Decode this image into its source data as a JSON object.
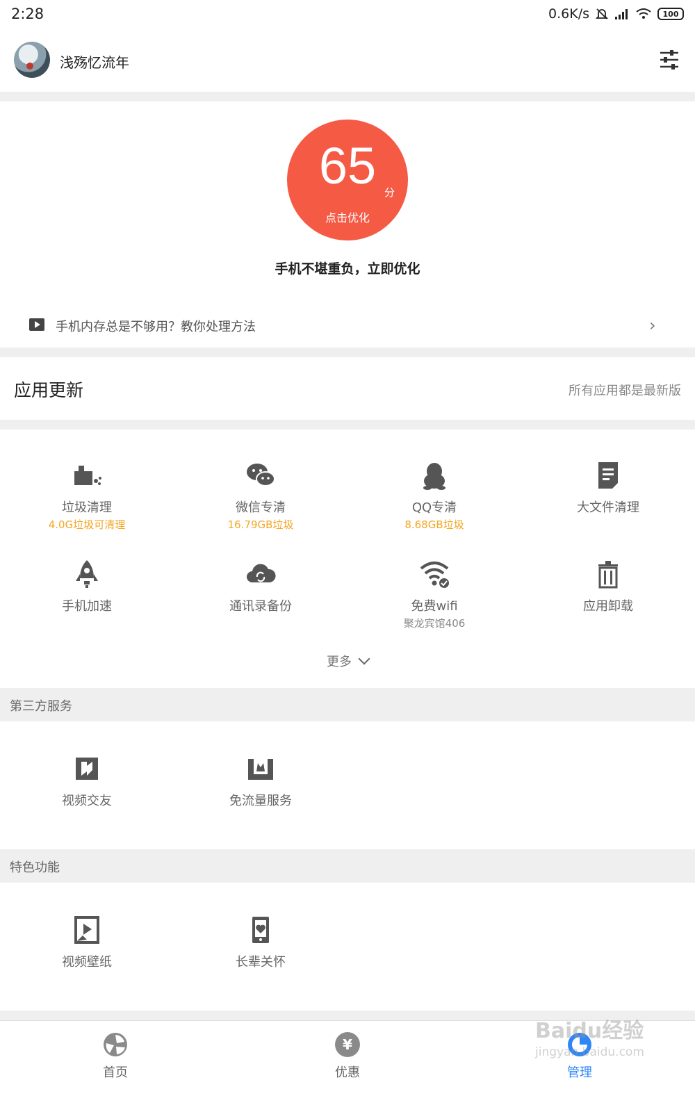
{
  "status_bar": {
    "time": "2:28",
    "speed": "0.6K/s",
    "battery": "100"
  },
  "header": {
    "username": "浅殇忆流年"
  },
  "score": {
    "value": "65",
    "unit": "分",
    "action": "点击优化",
    "message": "手机不堪重负，立即优化"
  },
  "tip": {
    "text": "手机内存总是不够用？教你处理方法"
  },
  "app_update": {
    "title": "应用更新",
    "status": "所有应用都是最新版"
  },
  "tools": [
    {
      "label": "垃圾清理",
      "sub": "4.0G垃圾可清理",
      "icon": "broom-icon"
    },
    {
      "label": "微信专清",
      "sub": "16.79GB垃圾",
      "icon": "wechat-icon"
    },
    {
      "label": "QQ专清",
      "sub": "8.68GB垃圾",
      "icon": "qq-penguin-icon"
    },
    {
      "label": "大文件清理",
      "sub": "",
      "icon": "document-icon"
    },
    {
      "label": "手机加速",
      "sub": "",
      "icon": "rocket-icon"
    },
    {
      "label": "通讯录备份",
      "sub": "",
      "icon": "cloud-sync-icon"
    },
    {
      "label": "免费wifi",
      "sub": "聚龙宾馆406",
      "icon": "wifi-check-icon"
    },
    {
      "label": "应用卸载",
      "sub": "",
      "icon": "trash-icon"
    }
  ],
  "more_label": "更多",
  "third_party": {
    "title": "第三方服务",
    "items": [
      {
        "label": "视频交友",
        "icon": "video-dating-icon"
      },
      {
        "label": "免流量服务",
        "icon": "free-data-icon"
      }
    ]
  },
  "features": {
    "title": "特色功能",
    "items": [
      {
        "label": "视频壁纸",
        "icon": "video-wallpaper-icon"
      },
      {
        "label": "长辈关怀",
        "icon": "elder-care-icon"
      }
    ]
  },
  "bottom_nav": [
    {
      "label": "首页",
      "icon": "home-swirl-icon"
    },
    {
      "label": "优惠",
      "icon": "yen-coin-icon",
      "glyph": "¥"
    },
    {
      "label": "管理",
      "icon": "manage-icon"
    }
  ],
  "watermark": {
    "title": "Baidu经验",
    "url": "jingyan.baidu.com"
  },
  "colors": {
    "score_red": "#f55a45",
    "accent_blue": "#2f86f6",
    "warning_yellow": "#f5a623"
  }
}
